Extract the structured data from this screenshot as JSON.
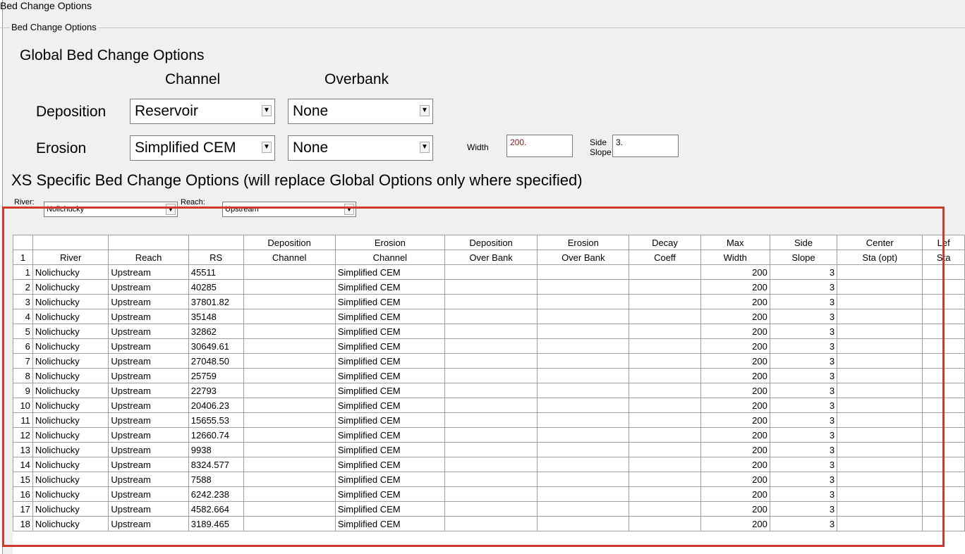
{
  "window_title": "Bed Change Options",
  "group_label": "Bed Change Options",
  "global": {
    "heading": "Global Bed Change Options",
    "col_channel": "Channel",
    "col_overbank": "Overbank",
    "deposition_label": "Deposition",
    "deposition_channel": "Reservoir",
    "deposition_overbank": "None",
    "erosion_label": "Erosion",
    "erosion_channel": "Simplified CEM",
    "erosion_overbank": "None",
    "width_label": "Width",
    "width_value": "200.",
    "side_label_1": "Side",
    "side_label_2": "Slope",
    "side_slope_value": "3."
  },
  "xs": {
    "heading": "XS Specific Bed Change Options (will replace Global Options only where specified)",
    "river_label": "River:",
    "river_value": "Nolichucky",
    "reach_label": "Reach:",
    "reach_value": "Upstream"
  },
  "table": {
    "header_top": [
      "",
      "",
      "",
      "",
      "Deposition",
      "Erosion",
      "Deposition",
      "Erosion",
      "Decay",
      "Max",
      "Side",
      "Center",
      "Lef"
    ],
    "header_bottom": [
      "1",
      "River",
      "Reach",
      "RS",
      "Channel",
      "Channel",
      "Over Bank",
      "Over Bank",
      "Coeff",
      "Width",
      "Slope",
      "Sta (opt)",
      "Sta"
    ],
    "rows": [
      [
        "1",
        "Nolichucky",
        "Upstream",
        "45511",
        "",
        "Simplified CEM",
        "",
        "",
        "",
        "200",
        "3",
        "",
        ""
      ],
      [
        "2",
        "Nolichucky",
        "Upstream",
        "40285",
        "",
        "Simplified CEM",
        "",
        "",
        "",
        "200",
        "3",
        "",
        ""
      ],
      [
        "3",
        "Nolichucky",
        "Upstream",
        "37801.82",
        "",
        "Simplified CEM",
        "",
        "",
        "",
        "200",
        "3",
        "",
        ""
      ],
      [
        "4",
        "Nolichucky",
        "Upstream",
        "35148",
        "",
        "Simplified CEM",
        "",
        "",
        "",
        "200",
        "3",
        "",
        ""
      ],
      [
        "5",
        "Nolichucky",
        "Upstream",
        "32862",
        "",
        "Simplified CEM",
        "",
        "",
        "",
        "200",
        "3",
        "",
        ""
      ],
      [
        "6",
        "Nolichucky",
        "Upstream",
        "30649.61",
        "",
        "Simplified CEM",
        "",
        "",
        "",
        "200",
        "3",
        "",
        ""
      ],
      [
        "7",
        "Nolichucky",
        "Upstream",
        "27048.50",
        "",
        "Simplified CEM",
        "",
        "",
        "",
        "200",
        "3",
        "",
        ""
      ],
      [
        "8",
        "Nolichucky",
        "Upstream",
        "25759",
        "",
        "Simplified CEM",
        "",
        "",
        "",
        "200",
        "3",
        "",
        ""
      ],
      [
        "9",
        "Nolichucky",
        "Upstream",
        "22793",
        "",
        "Simplified CEM",
        "",
        "",
        "",
        "200",
        "3",
        "",
        ""
      ],
      [
        "10",
        "Nolichucky",
        "Upstream",
        "20406.23",
        "",
        "Simplified CEM",
        "",
        "",
        "",
        "200",
        "3",
        "",
        ""
      ],
      [
        "11",
        "Nolichucky",
        "Upstream",
        "15655.53",
        "",
        "Simplified CEM",
        "",
        "",
        "",
        "200",
        "3",
        "",
        ""
      ],
      [
        "12",
        "Nolichucky",
        "Upstream",
        "12660.74",
        "",
        "Simplified CEM",
        "",
        "",
        "",
        "200",
        "3",
        "",
        ""
      ],
      [
        "13",
        "Nolichucky",
        "Upstream",
        "9938",
        "",
        "Simplified CEM",
        "",
        "",
        "",
        "200",
        "3",
        "",
        ""
      ],
      [
        "14",
        "Nolichucky",
        "Upstream",
        "8324.577",
        "",
        "Simplified CEM",
        "",
        "",
        "",
        "200",
        "3",
        "",
        ""
      ],
      [
        "15",
        "Nolichucky",
        "Upstream",
        "7588",
        "",
        "Simplified CEM",
        "",
        "",
        "",
        "200",
        "3",
        "",
        ""
      ],
      [
        "16",
        "Nolichucky",
        "Upstream",
        "6242.238",
        "",
        "Simplified CEM",
        "",
        "",
        "",
        "200",
        "3",
        "",
        ""
      ],
      [
        "17",
        "Nolichucky",
        "Upstream",
        "4582.664",
        "",
        "Simplified CEM",
        "",
        "",
        "",
        "200",
        "3",
        "",
        ""
      ],
      [
        "18",
        "Nolichucky",
        "Upstream",
        "3189.465",
        "",
        "Simplified CEM",
        "",
        "",
        "",
        "200",
        "3",
        "",
        ""
      ]
    ]
  },
  "colors": {
    "highlight": "#d03a2c",
    "background": "#f0f0f0"
  }
}
